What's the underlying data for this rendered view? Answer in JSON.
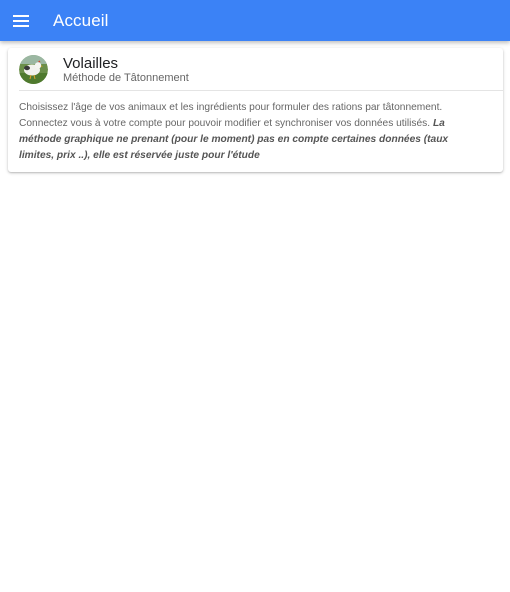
{
  "toolbar": {
    "menu_icon": "hamburger-menu-icon",
    "title": "Accueil",
    "color": "#3b82f6"
  },
  "card": {
    "avatar_icon": "chicken-avatar-icon",
    "title": "Volailles",
    "subtitle": "Méthode de Tâtonnement",
    "description": "Choisissez l'âge de vos animaux et les ingrédients pour formuler des rations par tâtonnement. Connectez vous à votre compte pour pouvoir modifier et synchroniser vos données utilisés. ",
    "note": "La méthode graphique ne prenant (pour le moment) pas en compte certaines données (taux limites, prix ..), elle est réservée juste pour l'étude"
  }
}
